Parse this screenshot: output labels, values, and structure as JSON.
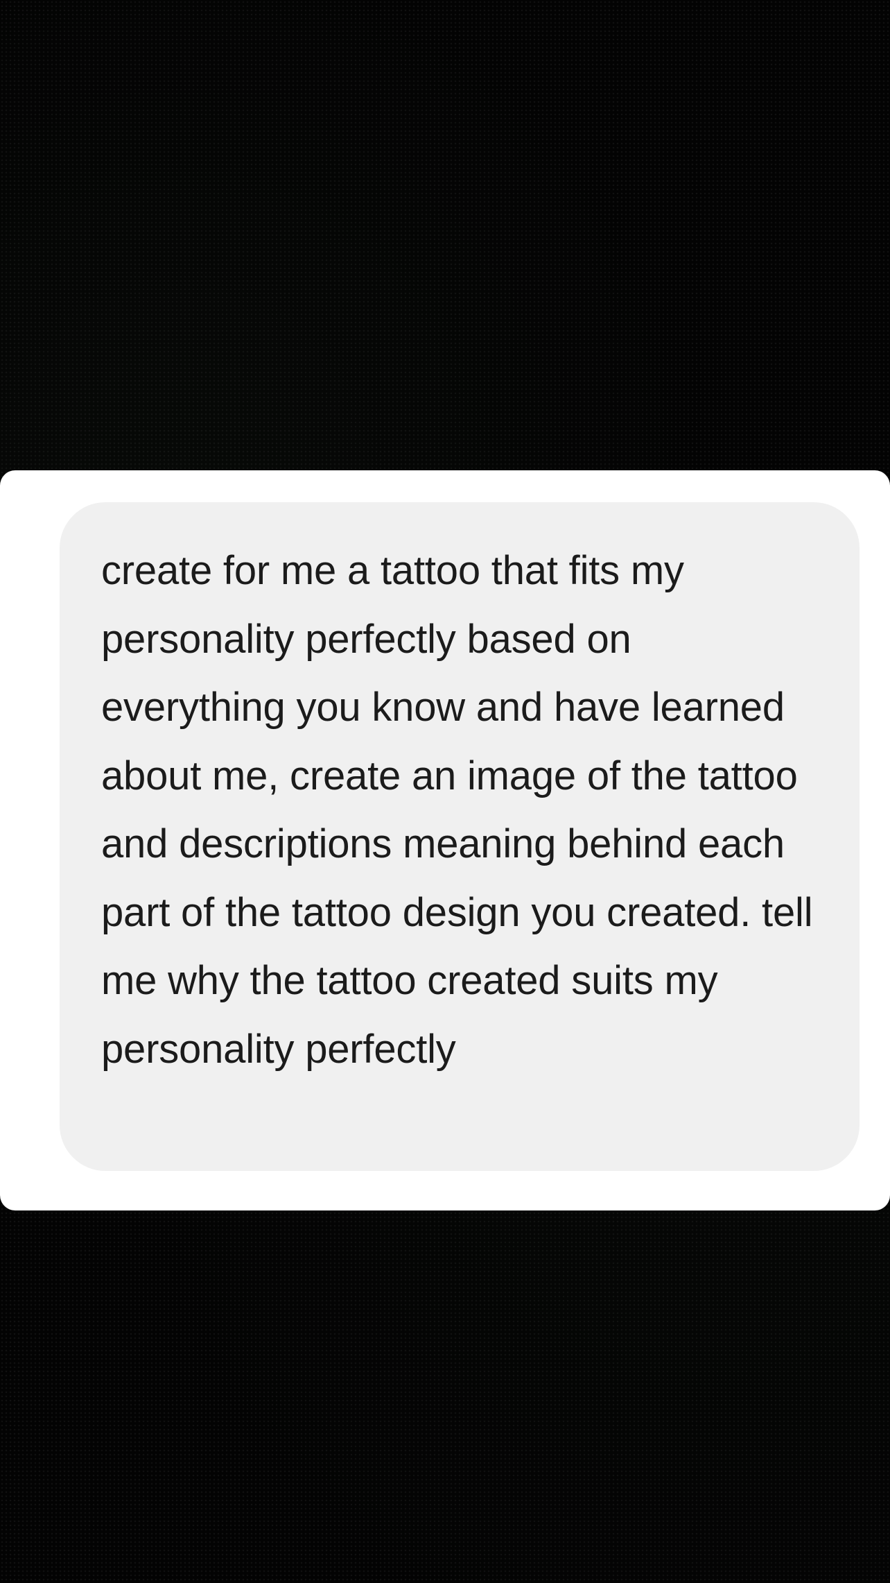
{
  "chat": {
    "user_message": "create for me a tattoo that fits my personality perfectly based on everything you know and have learned about me, create an image of the tattoo and descriptions meaning behind each part of the tattoo design you created. tell me why the tattoo created suits my personality perfectly"
  },
  "colors": {
    "background": "#000000",
    "card": "#ffffff",
    "bubble": "#f0f0f0",
    "text": "#1b1b1b"
  }
}
